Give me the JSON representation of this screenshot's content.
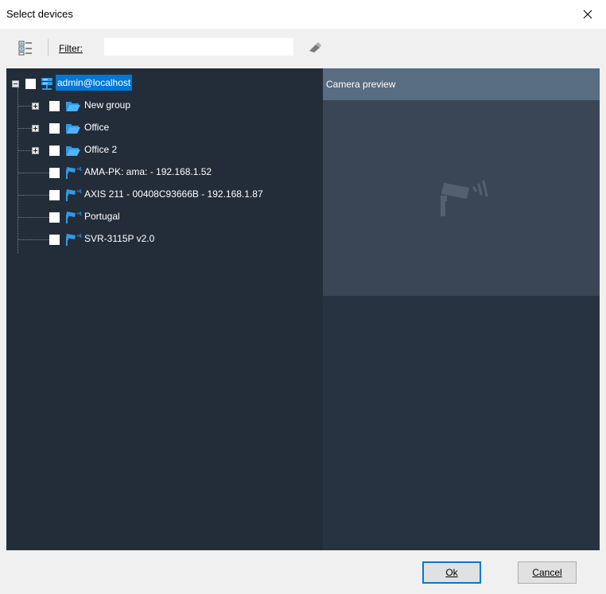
{
  "window": {
    "title": "Select devices"
  },
  "toolbar": {
    "filter_label": "Filter:",
    "filter_value": "",
    "filter_placeholder": ""
  },
  "tree": {
    "root": {
      "label": "admin@localhost"
    },
    "groups": [
      {
        "label": "New group"
      },
      {
        "label": "Office"
      },
      {
        "label": "Office 2"
      }
    ],
    "cameras": [
      {
        "label": "AMA-PK: ama: - 192.168.1.52"
      },
      {
        "label": "AXIS 211 - 00408C93666B - 192.168.1.87"
      },
      {
        "label": "Portugal"
      },
      {
        "label": "SVR-3115P v2.0"
      }
    ]
  },
  "preview": {
    "header": "Camera preview"
  },
  "buttons": {
    "ok": "Ok",
    "cancel": "Cancel"
  },
  "colors": {
    "tree_bg": "#232d3a",
    "preview_header": "#586c82",
    "selection": "#0078d7",
    "folder": "#2e9be8"
  },
  "icons": [
    "tree-view-icon",
    "eraser-icon",
    "server-icon",
    "folder-icon",
    "camera-icon",
    "close-icon"
  ]
}
